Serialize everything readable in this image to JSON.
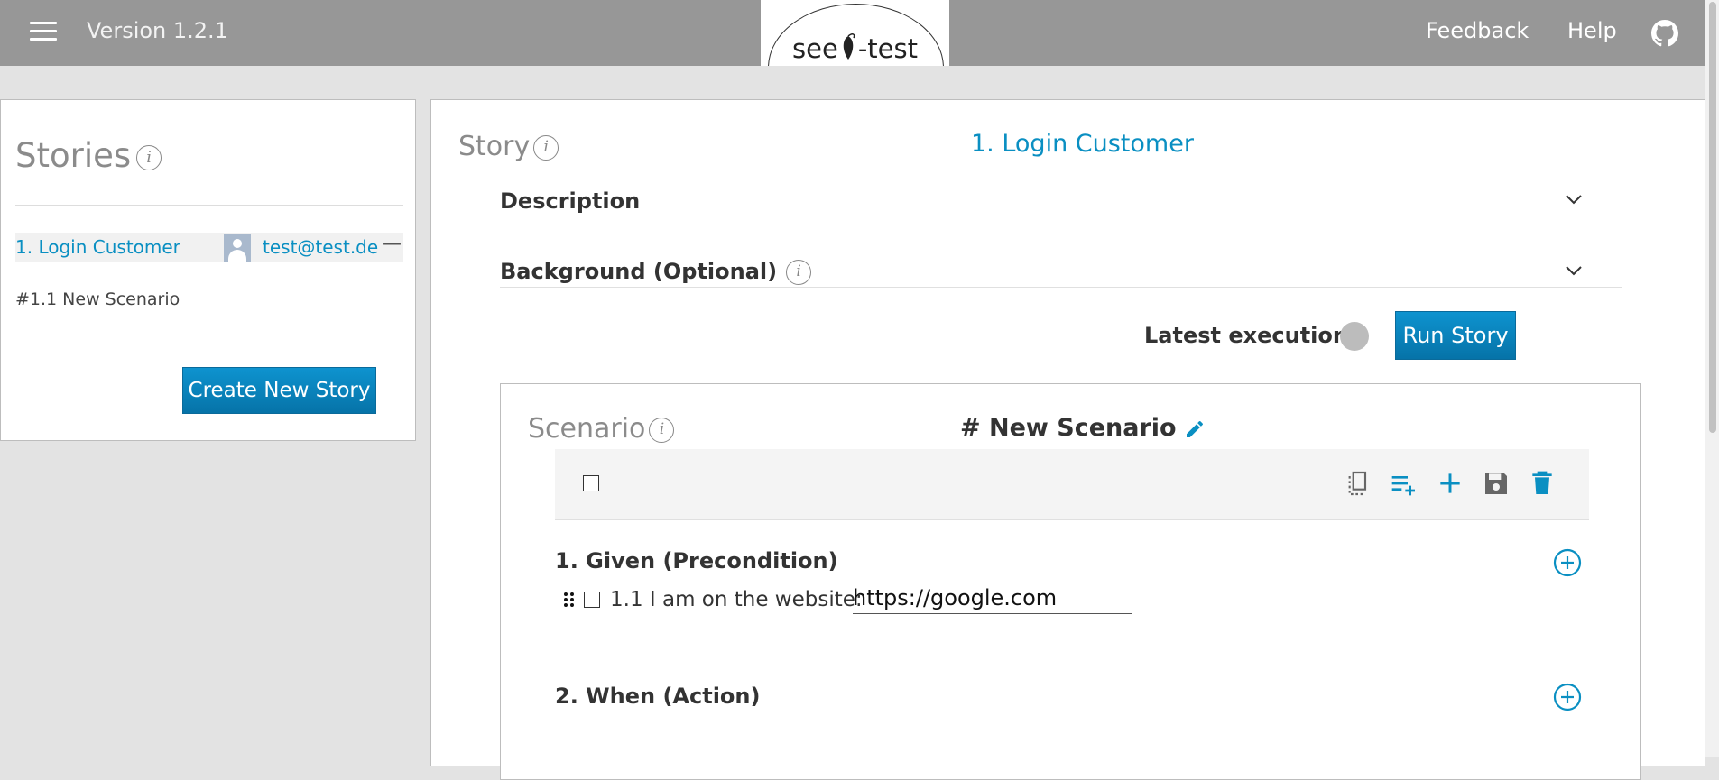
{
  "header": {
    "version": "Version 1.2.1",
    "logo_text_left": "see",
    "logo_text_right": "-test",
    "feedback": "Feedback",
    "help": "Help",
    "github_icon": "github-icon"
  },
  "sidebar": {
    "title": "Stories",
    "stories": [
      {
        "title": "1. Login Customer",
        "assignee": "test@test.de",
        "action": "—"
      }
    ],
    "scenarios": [
      "#1.1 New Scenario"
    ],
    "create_button": "Create New Story"
  },
  "story": {
    "label": "Story",
    "title": "1. Login Customer",
    "description_label": "Description",
    "background_label": "Background (Optional)",
    "latest_execution_label": "Latest execution:",
    "run_button": "Run Story",
    "scenario": {
      "label": "Scenario",
      "title": "# New Scenario",
      "steps": {
        "given": {
          "label": "1. Given (Precondition)",
          "items": [
            {
              "text": "1.1 I am on the website:",
              "value": "https://google.com"
            }
          ]
        },
        "when": {
          "label": "2. When (Action)"
        }
      }
    }
  },
  "colors": {
    "topbar": "#979797",
    "accent": "#0a8fc2",
    "button": "#0a7fb7",
    "status_idle": "#bcbcbc"
  }
}
